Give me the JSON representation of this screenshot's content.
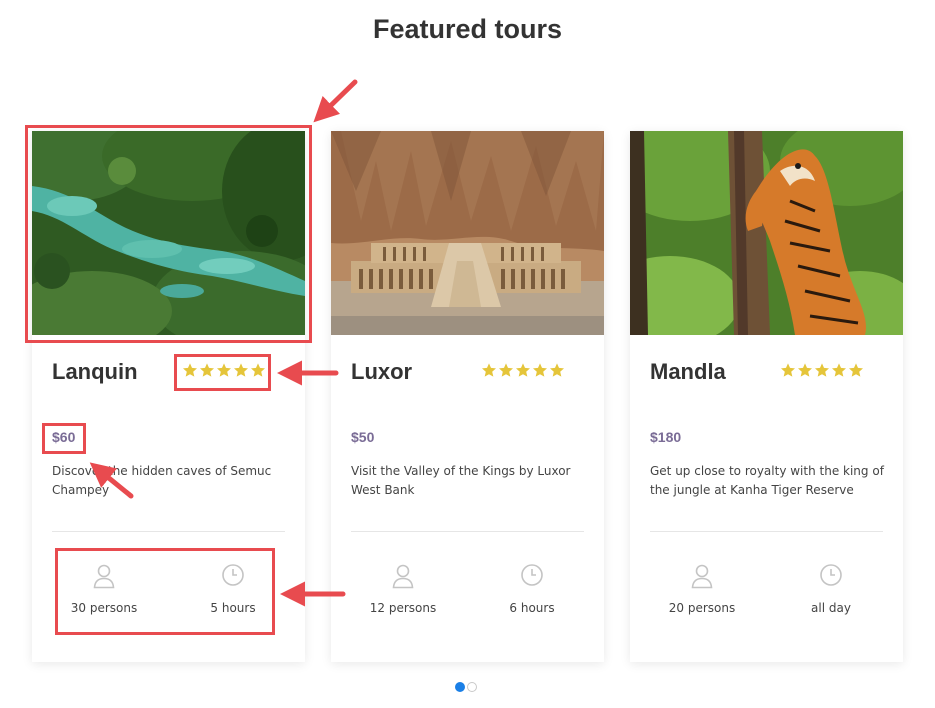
{
  "section_title": "Featured tours",
  "tours": [
    {
      "name": "Lanquin",
      "rating": 5,
      "price": "$60",
      "description": "Discover the hidden caves of Semuc Champey",
      "description_visible": "Discover the hidden caves of Semuc Champey",
      "persons": "30 persons",
      "duration": "5 hours",
      "image": "turquoise-pools-in-jungle"
    },
    {
      "name": "Luxor",
      "rating": 5,
      "price": "$50",
      "description": "Visit the Valley of the Kings by Luxor West Bank",
      "persons": "12 persons",
      "duration": "6 hours",
      "image": "temple-below-cliffs"
    },
    {
      "name": "Mandla",
      "rating": 5,
      "price": "$180",
      "description": "Get up close to royalty with the king of the jungle at Kanha Tiger Reserve",
      "persons": "20 persons",
      "duration": "all day",
      "image": "tiger-against-tree"
    }
  ],
  "carousel": {
    "pages": 2,
    "active_page": 1
  },
  "icons": {
    "star": "star-icon",
    "persons": "person-icon",
    "duration": "clock-icon"
  },
  "colors": {
    "star": "#e5c53a",
    "price": "#7a6c96",
    "annotation": "#e84b4f",
    "dot_active": "#1a7fe6"
  }
}
